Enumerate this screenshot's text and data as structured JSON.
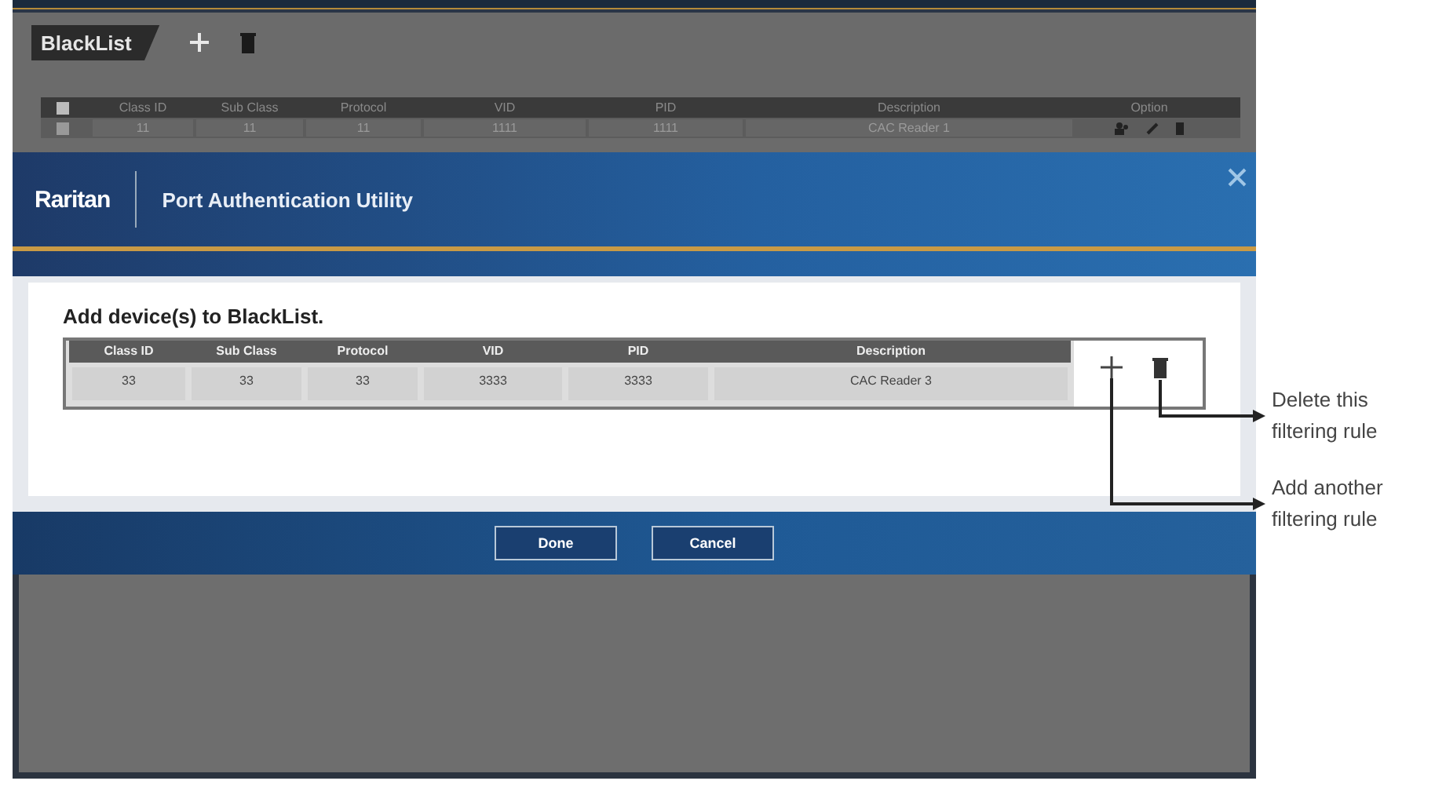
{
  "background_list": {
    "title": "BlackList",
    "columns": [
      "Class ID",
      "Sub Class",
      "Protocol",
      "VID",
      "PID",
      "Description",
      "Option"
    ],
    "rows": [
      {
        "cells": [
          "11",
          "11",
          "11",
          "1111",
          "1111",
          "CAC Reader 1"
        ]
      }
    ]
  },
  "dialog": {
    "brand": "Raritan",
    "title": "Port Authentication Utility",
    "heading": "Add device(s) to BlackList.",
    "columns": [
      "Class ID",
      "Sub Class",
      "Protocol",
      "VID",
      "PID",
      "Description"
    ],
    "rows": [
      {
        "cells": [
          "33",
          "33",
          "33",
          "3333",
          "3333",
          "CAC Reader 3"
        ]
      }
    ],
    "buttons": [
      "Done",
      "Cancel"
    ]
  },
  "annotations": [
    {
      "kind": "delete",
      "text": "Delete this filtering rule"
    },
    {
      "kind": "add",
      "text": "Add another filtering rule"
    }
  ]
}
